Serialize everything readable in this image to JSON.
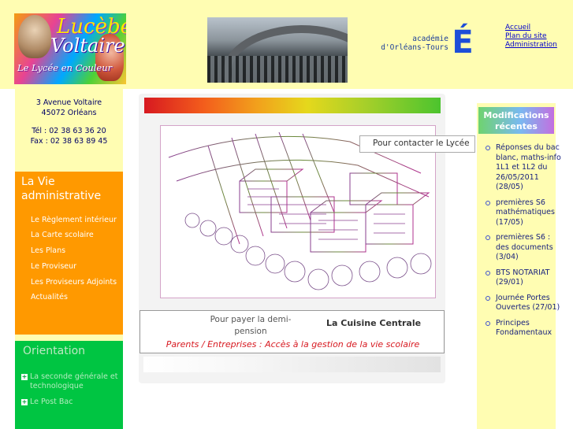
{
  "header": {
    "logo": {
      "name_line1": "Lucèbe",
      "name_line2": "Voltaire",
      "tagline": "Le Lycée en Couleur"
    },
    "academie": {
      "line1": "académie",
      "line2": "d'Orléans-Tours",
      "mark": "É"
    },
    "links": [
      "Accueil",
      "Plan du site",
      "Administration"
    ]
  },
  "contact": {
    "street": "3 Avenue Voltaire",
    "city": "45072 Orléans",
    "tel": "Tél : 02 38 63 36 20",
    "fax": "Fax : 02 38 63 89 45"
  },
  "vie_admin": {
    "title": "La Vie administrative",
    "items": [
      "Le Règlement intérieur",
      "La Carte scolaire",
      "Les Plans",
      "Le Proviseur",
      "Les Proviseurs Adjoints",
      "Actualités"
    ]
  },
  "orientation": {
    "title": "Orientation",
    "items": [
      "La seconde générale et technologique",
      "Le Post Bac"
    ]
  },
  "main": {
    "tooltip": "Pour contacter le Lycée",
    "pay_link": "Pour payer la demi-pension",
    "cuisine_link": "La Cuisine Centrale",
    "parents_link": "Parents / Entreprises : Accès à la gestion de la vie scolaire"
  },
  "recent": {
    "title": "Modifications récentes",
    "items": [
      "Réponses du bac blanc, maths-info 1L1 et 1L2 du 26/05/2011 (28/05)",
      "premières S6 mathématiques (17/05)",
      "premières S6 : des documents (3/04)",
      "BTS NOTARIAT (29/01)",
      "Journée Portes Ouvertes (27/01)",
      "Principes Fondamentaux"
    ]
  },
  "colors": {
    "header_bg": "#fffdb2",
    "admin_orange": "#ff9900",
    "orientation_green": "#00c542",
    "parents_red": "#d71920",
    "link_blue": "#0000cc"
  }
}
